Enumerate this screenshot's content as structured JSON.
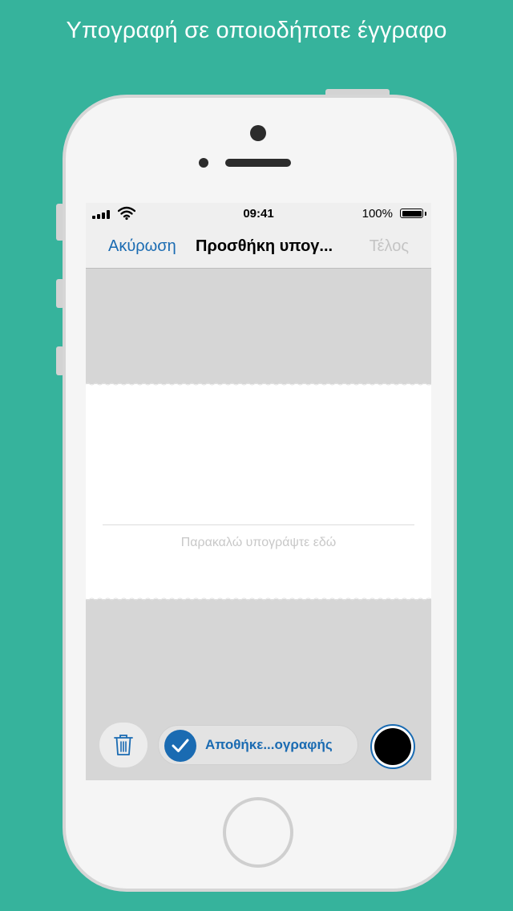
{
  "headline": "Υπογραφή σε οποιοδήποτε έγγραφο",
  "colors": {
    "background": "#36b39c",
    "accent": "#1a6bb2",
    "pen_color": "#000000",
    "disabled": "#c4c4c4"
  },
  "status_bar": {
    "time": "09:41",
    "battery": "100%",
    "icons": [
      "signal-icon",
      "wifi-icon",
      "battery-icon"
    ]
  },
  "nav": {
    "cancel": "Ακύρωση",
    "title": "Προσθήκη υπογ...",
    "done": "Τέλος"
  },
  "signature_pad": {
    "hint": "Παρακαλώ υπογράψτε εδώ"
  },
  "toolbar": {
    "trash_icon": "trash-icon",
    "save_toggle_label": "Αποθήκε...ογραφής",
    "save_toggle_checked": true,
    "pen_color_swatch": "#000000"
  }
}
